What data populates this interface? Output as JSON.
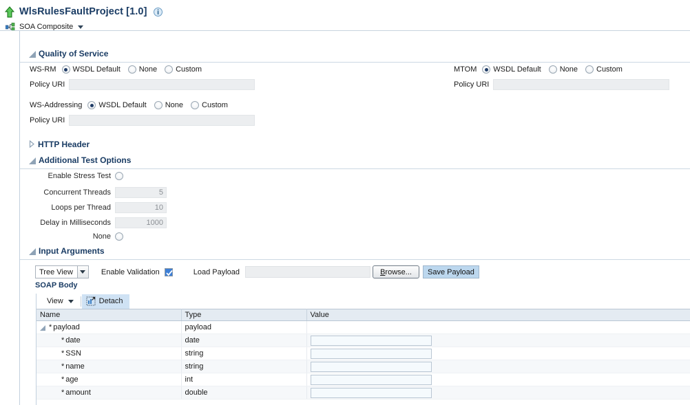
{
  "header": {
    "title": "WlsRulesFaultProject [1.0]",
    "up_arrow_icon": "up-arrow-icon",
    "info_icon": "info-icon",
    "subtitle": "SOA Composite",
    "composite_icon": "soa-composite-icon"
  },
  "quality_of_service": {
    "section_title": "Quality of Service",
    "wsrm": {
      "label": "WS-RM",
      "options": [
        "WSDL Default",
        "None",
        "Custom"
      ],
      "selected": "WSDL Default",
      "policy_uri_label": "Policy URI",
      "policy_uri_value": ""
    },
    "mtom": {
      "label": "MTOM",
      "options": [
        "WSDL Default",
        "None",
        "Custom"
      ],
      "selected": "WSDL Default",
      "policy_uri_label": "Policy URI",
      "policy_uri_value": ""
    },
    "ws_addressing": {
      "label": "WS-Addressing",
      "options": [
        "WSDL Default",
        "None",
        "Custom"
      ],
      "selected": "WSDL Default",
      "policy_uri_label": "Policy URI",
      "policy_uri_value": ""
    }
  },
  "http_header": {
    "section_title": "HTTP Header",
    "expanded": false
  },
  "additional_test_options": {
    "section_title": "Additional Test Options",
    "rows": [
      {
        "label": "Enable Stress Test",
        "type": "radio",
        "checked": false
      },
      {
        "label": "Concurrent Threads",
        "type": "number",
        "value": "5"
      },
      {
        "label": "Loops per Thread",
        "type": "number",
        "value": "10"
      },
      {
        "label": "Delay in Milliseconds",
        "type": "number",
        "value": "1000"
      },
      {
        "label": "None",
        "type": "radio",
        "checked": false
      }
    ]
  },
  "input_arguments": {
    "section_title": "Input Arguments",
    "view_select": {
      "value": "Tree View"
    },
    "enable_validation": {
      "label": "Enable Validation",
      "checked": true
    },
    "load_payload": {
      "label": "Load Payload",
      "value": ""
    },
    "browse_button": "Browse...",
    "save_payload_button": "Save Payload",
    "soap_body_label": "SOAP Body",
    "table_toolbar": {
      "view_menu": "View",
      "detach_button": "Detach",
      "detach_icon": "detach-icon"
    },
    "table": {
      "columns": [
        "Name",
        "Type",
        "Value"
      ],
      "rows": [
        {
          "name": "payload",
          "type": "payload",
          "value": "",
          "level": 0,
          "required": true,
          "expandable": true,
          "expanded": true,
          "has_input": false
        },
        {
          "name": "date",
          "type": "date",
          "value": "",
          "level": 1,
          "required": true,
          "expandable": false,
          "has_input": true
        },
        {
          "name": "SSN",
          "type": "string",
          "value": "",
          "level": 1,
          "required": true,
          "expandable": false,
          "has_input": true
        },
        {
          "name": "name",
          "type": "string",
          "value": "",
          "level": 1,
          "required": true,
          "expandable": false,
          "has_input": true
        },
        {
          "name": "age",
          "type": "int",
          "value": "",
          "level": 1,
          "required": true,
          "expandable": false,
          "has_input": true
        },
        {
          "name": "amount",
          "type": "double",
          "value": "",
          "level": 1,
          "required": true,
          "expandable": false,
          "has_input": true
        }
      ]
    }
  },
  "colors": {
    "title_blue": "#1a3c64",
    "radio_fill": "#1f3b66",
    "checkbox_blue": "#3d7fd6",
    "table_header_bg": "#e4ebf2",
    "detach_bg": "#cfe2f4",
    "save_btn_bg": "#bcd7ee",
    "field_disabled_bg": "#eceef0",
    "value_input_bg": "#f5fafd"
  }
}
